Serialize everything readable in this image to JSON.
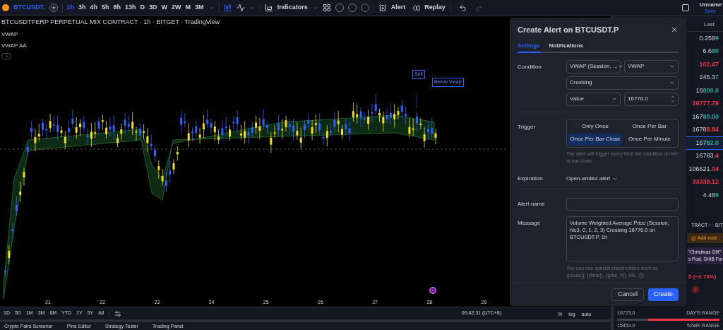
{
  "toolbar": {
    "symbol": "BTCUSDT.",
    "timeframes": [
      {
        "label": "1h",
        "selected": true
      },
      {
        "label": "3h",
        "selected": false
      },
      {
        "label": "4h",
        "selected": false
      },
      {
        "label": "5h",
        "selected": false
      },
      {
        "label": "8h",
        "selected": false
      },
      {
        "label": "13h",
        "selected": false
      },
      {
        "label": "D",
        "selected": false
      },
      {
        "label": "3D",
        "selected": false
      },
      {
        "label": "W",
        "selected": false
      },
      {
        "label": "2W",
        "selected": false
      },
      {
        "label": "M",
        "selected": false
      },
      {
        "label": "3M",
        "selected": false
      }
    ],
    "indicators": "Indicators",
    "alert": "Alert",
    "replay": "Replay",
    "layout_name": "Unname",
    "save": "Save"
  },
  "chart": {
    "title": "BTCUSDTPERP PERPETUAL MIX CONTRACT · 1h · BITGET · TradingView",
    "indicators": [
      "VWAP",
      "VWAP AA"
    ],
    "markers": [
      "Sell",
      "Below Vwap"
    ],
    "x_labels": [
      "21",
      "22",
      "23",
      "24",
      "25",
      "26",
      "27",
      "28",
      "29"
    ]
  },
  "range_bar": {
    "ranges": [
      "1D",
      "5D",
      "1M",
      "3M",
      "6M",
      "YTD",
      "1Y",
      "5Y",
      "All"
    ],
    "time": "00:42:31 (UTC+8)",
    "options": [
      "%",
      "log",
      "auto"
    ]
  },
  "bottom_tabs": [
    "Crypto Pairs Screener",
    "Pine Editor",
    "Strategy Tester",
    "Trading Panel"
  ],
  "watchlist": {
    "column": "Last",
    "rows": [
      {
        "head": "0.259",
        "tail": "9",
        "color": "#26a69a",
        "selected": false
      },
      {
        "head": "6.6",
        "tail": "80",
        "color": "#26a69a",
        "selected": false
      },
      {
        "head": "",
        "tail": "102.47",
        "color": "#f23645",
        "selected": false
      },
      {
        "head": "245.3",
        "tail": "7",
        "color": "#26a69a",
        "selected": false
      },
      {
        "head": "16",
        "tail": "800.0",
        "color": "#26a69a",
        "selected": false
      },
      {
        "head": "",
        "tail": "16777.79",
        "color": "#f23645",
        "selected": false
      },
      {
        "head": "167",
        "tail": "80.00",
        "color": "#26a69a",
        "selected": false
      },
      {
        "head": "1678",
        "tail": "8.84",
        "color": "#f23645",
        "selected": false
      },
      {
        "head": "167",
        "tail": "82.0",
        "color": "#26a69a",
        "selected": true
      },
      {
        "head": "16783.",
        "tail": "4",
        "color": "#f23645",
        "selected": false
      },
      {
        "head": "106621.",
        "tail": "04",
        "color": "#f23645",
        "selected": false
      },
      {
        "head": "",
        "tail": "33339.12",
        "color": "#f23645",
        "selected": false
      },
      {
        "head": "4.48",
        "tail": "9",
        "color": "#26a69a",
        "selected": false
      }
    ]
  },
  "details": {
    "name_fragment": "TRACT",
    "exchange_fragment": "· BIT",
    "add_note": "Add note",
    "news_headline": "\"Christmas Gift\"",
    "news_sub": "s Post, SHIB For",
    "change": "5 (−0.73%)",
    "badge": "8",
    "day_low": "16723.0",
    "day_range": "DAY'S RANGE",
    "day_range_bar": {
      "level": 0.7
    },
    "week_low": "15453.0",
    "week_range": "52WK RANGE"
  },
  "dialog": {
    "title": "Create Alert on BTCUSDT.P",
    "tabs": [
      {
        "label": "Settings",
        "selected": true
      },
      {
        "label": "Notifications",
        "selected": false
      }
    ],
    "condition_label": "Condition",
    "condition": {
      "source": "VWAP (Session, ...",
      "plot": "VWAP",
      "operator": "Crossing",
      "target": "Value",
      "value": "16776.0"
    },
    "trigger_label": "Trigger",
    "triggers": [
      {
        "label": "Only Once",
        "selected": false
      },
      {
        "label": "Once Per Bar",
        "selected": false
      },
      {
        "label": "Once Per Bar Close",
        "selected": true
      },
      {
        "label": "Once Per Minute",
        "selected": false
      }
    ],
    "trigger_hint": "The alert will trigger every time the condition is met at bar close",
    "expiration_label": "Expiration",
    "expiration": "Open-ended alert",
    "alert_name_label": "Alert name",
    "message_label": "Message",
    "message": "Volume Weighted Average Price (Session, hlc3, 0, 1, 2, 3) Crossing 16776.0 on BTCUSDT.P, 1h",
    "message_hint": "You can use special placeholders such as {{close}}, {{time}}, {{plot_0}}, etc.",
    "cancel": "Cancel",
    "create": "Create"
  }
}
